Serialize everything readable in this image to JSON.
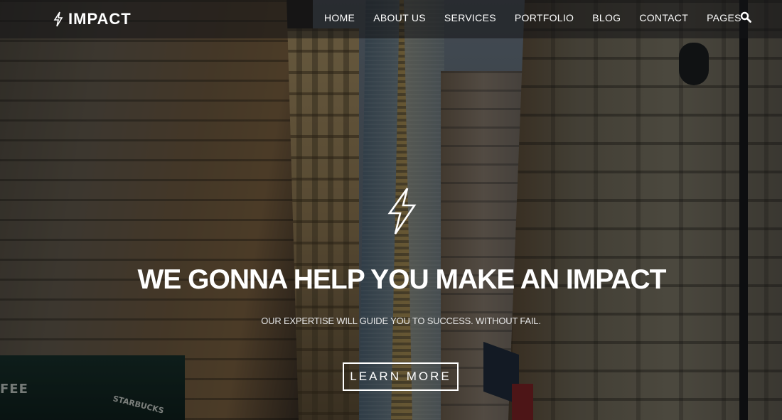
{
  "brand": {
    "name": "IMPACT",
    "icon": "lightning-bolt-icon"
  },
  "nav": {
    "items": [
      {
        "label": "HOME"
      },
      {
        "label": "ABOUT US"
      },
      {
        "label": "SERVICES"
      },
      {
        "label": "PORTFOLIO"
      },
      {
        "label": "BLOG"
      },
      {
        "label": "CONTACT"
      },
      {
        "label": "PAGES"
      }
    ],
    "search_icon": "search-icon"
  },
  "hero": {
    "icon": "lightning-bolt-icon",
    "title": "WE GONNA HELP YOU MAKE AN IMPACT",
    "subtitle": "OUR EXPERTISE WILL GUIDE YOU TO SUCCESS. WITHOUT FAIL.",
    "cta_label": "LEARN MORE"
  },
  "background": {
    "description": "city street with skyscraper",
    "visible_signage": [
      "FEE",
      "STARBUCKS"
    ]
  },
  "colors": {
    "text": "#ffffff",
    "header_overlay": "#141416"
  }
}
